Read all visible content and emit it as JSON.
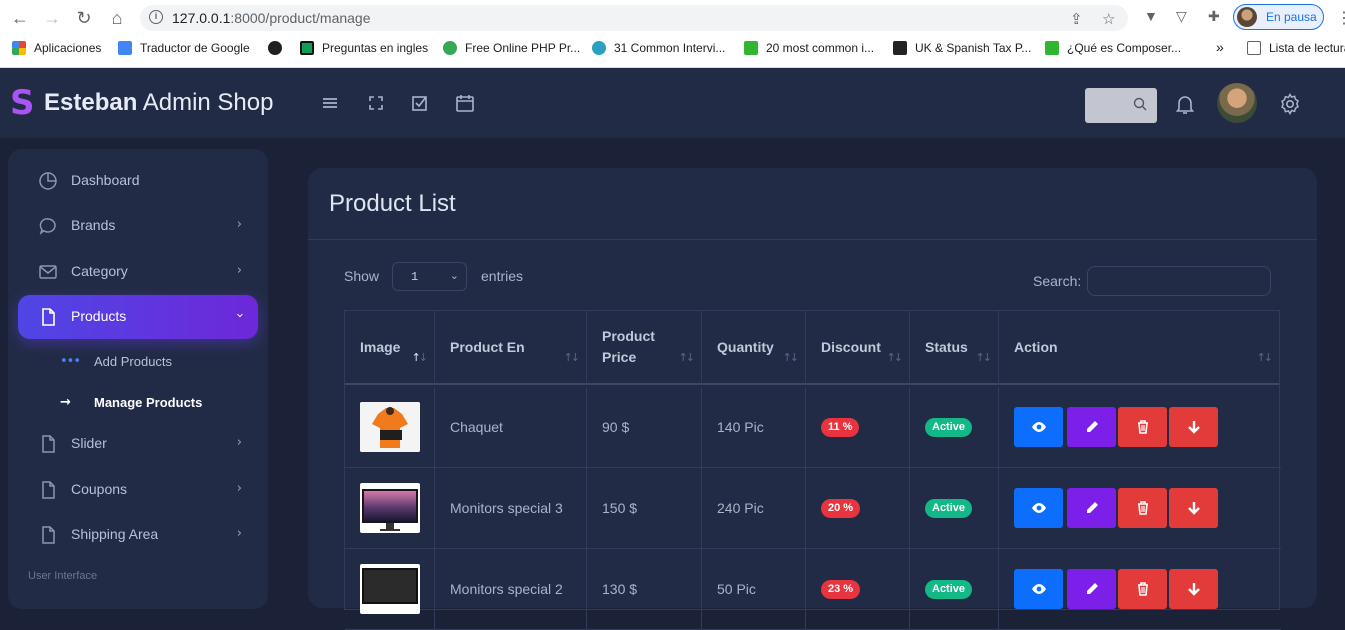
{
  "browser": {
    "url_host": "127.0.0.1",
    "url_path": ":8000/product/manage",
    "profile_label": "En pausa",
    "bookmarks": [
      {
        "label": "Aplicaciones",
        "color": "#ea4335"
      },
      {
        "label": "Traductor de Google",
        "color": "#4285f4"
      },
      {
        "label": "",
        "color": "#202124"
      },
      {
        "label": "Preguntas en ingles",
        "color": "#0f9d58"
      },
      {
        "label": "Free Online PHP Pr...",
        "color": "#34a853"
      },
      {
        "label": "31 Common Intervi...",
        "color": "#2aa1c0"
      },
      {
        "label": "20 most common i...",
        "color": "#2fb52f"
      },
      {
        "label": "UK & Spanish Tax P...",
        "color": "#222222"
      },
      {
        "label": "¿Qué es Composer...",
        "color": "#2fb52f"
      }
    ],
    "more_bookmarks": "»",
    "reading_list": "Lista de lectura"
  },
  "header": {
    "logo_letter": "S",
    "brand_bold": "Esteban",
    "brand_rest": " Admin Shop"
  },
  "sidebar": {
    "items": [
      {
        "label": "Dashboard",
        "has_chevron": false
      },
      {
        "label": "Brands",
        "has_chevron": true
      },
      {
        "label": "Category",
        "has_chevron": true
      },
      {
        "label": "Products",
        "has_chevron": true,
        "active": true
      },
      {
        "label": "Slider",
        "has_chevron": true
      },
      {
        "label": "Coupons",
        "has_chevron": true
      },
      {
        "label": "Shipping Area",
        "has_chevron": true
      }
    ],
    "sub_items": [
      {
        "label": "Add Products"
      },
      {
        "label": "Manage Products"
      }
    ],
    "section": "User Interface"
  },
  "main": {
    "title": "Product List",
    "show_label": "Show",
    "entries_value": "1",
    "entries_label": "entries",
    "search_label": "Search:",
    "columns": [
      "Image",
      "Product En",
      "Product Price",
      "Quantity",
      "Discount",
      "Status",
      "Action"
    ],
    "rows": [
      {
        "name": "Chaquet",
        "price": "90 $",
        "qty": "140 Pic",
        "discount": "11 %",
        "status": "Active"
      },
      {
        "name": "Monitors special 3",
        "price": "150 $",
        "qty": "240 Pic",
        "discount": "20 %",
        "status": "Active"
      },
      {
        "name": "Monitors special 2",
        "price": "130 $",
        "qty": "50 Pic",
        "discount": "23 %",
        "status": "Active"
      }
    ]
  },
  "colors": {
    "accent": "#6d28d9",
    "view": "#0d6efd",
    "edit": "#7c1fe8",
    "danger": "#e33a3a",
    "success": "#12b886"
  }
}
